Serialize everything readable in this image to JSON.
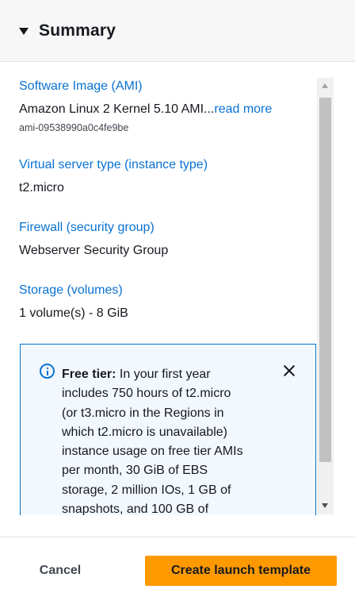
{
  "header": {
    "title": "Summary"
  },
  "summary": {
    "ami": {
      "label": "Software Image (AMI)",
      "value": "Amazon Linux 2 Kernel 5.10 AMI...",
      "read_more": "read more",
      "id": "ami-09538990a0c4fe9be"
    },
    "instance_type": {
      "label": "Virtual server type (instance type)",
      "value": "t2.micro"
    },
    "firewall": {
      "label": "Firewall (security group)",
      "value": "Webserver Security Group"
    },
    "storage": {
      "label": "Storage (volumes)",
      "value": "1 volume(s) - 8 GiB"
    }
  },
  "alert": {
    "lines": [
      "In your first year",
      "includes 750 hours of t2.micro",
      "(or t3.micro in the Regions in",
      "which t2.micro is unavailable)",
      "instance usage on free tier AMIs",
      "per month, 30 GiB of EBS",
      "storage, 2 million IOs, 1 GB of",
      "snapshots, and 100 GB of"
    ],
    "title": "Free tier:"
  },
  "footer": {
    "cancel_label": "Cancel",
    "create_label": "Create launch template"
  },
  "colors": {
    "accent": "#0972d3",
    "primary_button": "#ff9900",
    "header_bg": "#f7f7f7",
    "alert_bg": "#f2f8fd"
  },
  "icons": {
    "caret": "caret-down-icon",
    "info": "info-icon",
    "close": "close-icon"
  }
}
